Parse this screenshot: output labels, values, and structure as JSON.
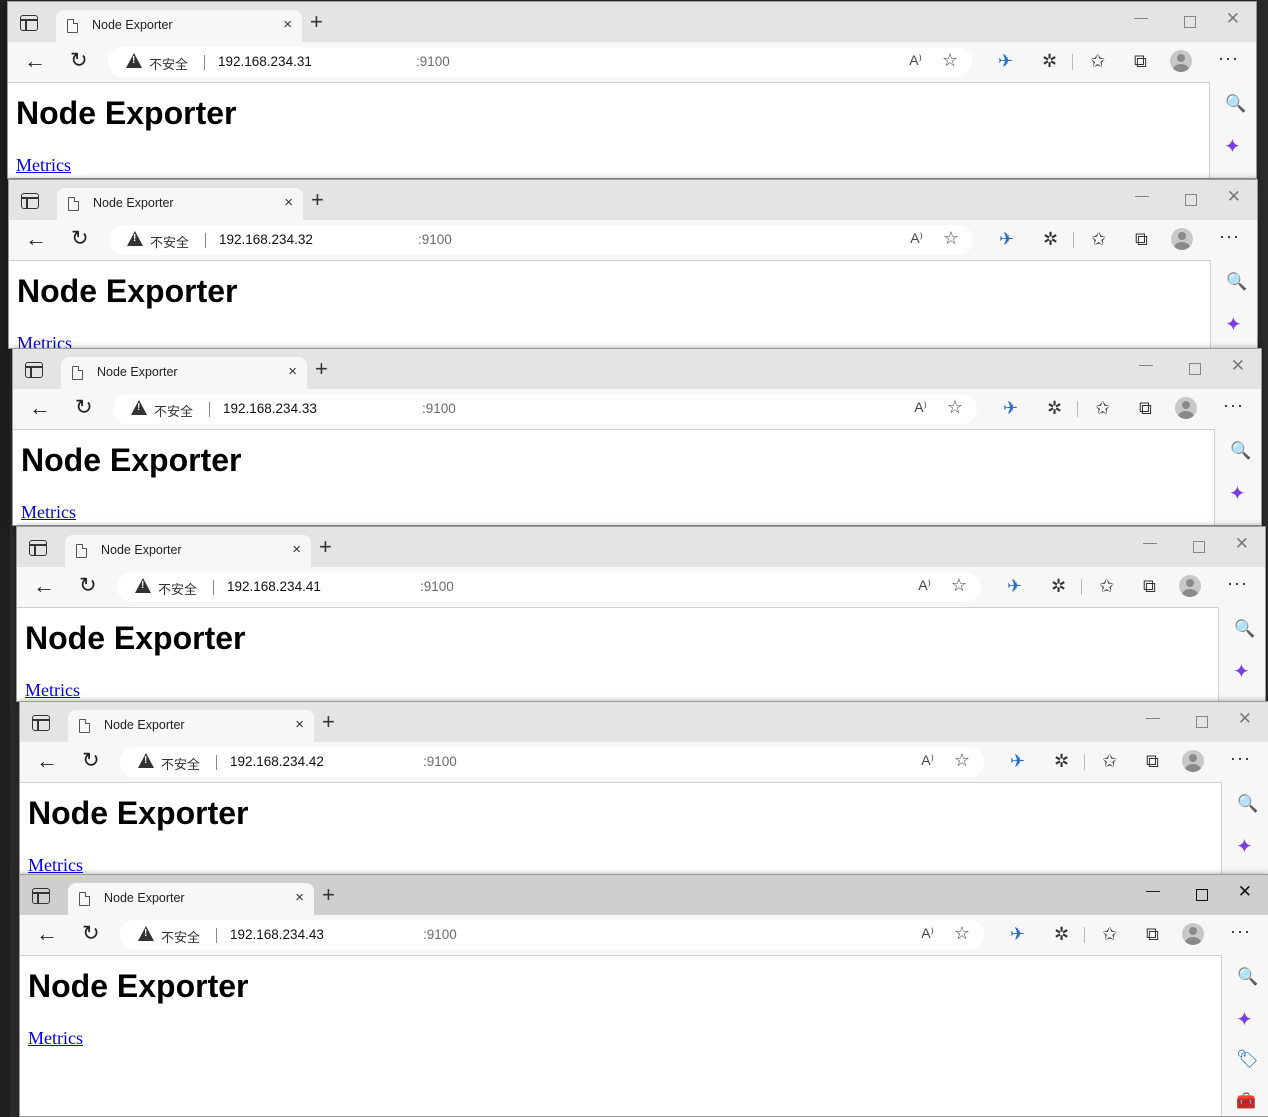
{
  "tab": {
    "title": "Node Exporter",
    "close_label": "×",
    "new_tab_label": "+"
  },
  "window_controls": {
    "minimize": "—",
    "close": "✕"
  },
  "nav": {
    "back": "←",
    "reload": "↻"
  },
  "address": {
    "security_label": "不安全"
  },
  "page": {
    "heading": "Node Exporter",
    "link_text": "Metrics"
  },
  "toolbar_icons": {
    "read_aloud": "A⁾",
    "favorite_add": "☆",
    "performance": "✈",
    "extensions": "✲",
    "favorites": "✩",
    "collections": "⧉",
    "more": "···"
  },
  "sidebar_icons": {
    "search": "🔍",
    "copilot": "✦",
    "shopping": "🏷",
    "tools": "🧰"
  },
  "windows": [
    {
      "host": "192.168.234.31",
      "port": ":9100",
      "active": false
    },
    {
      "host": "192.168.234.32",
      "port": ":9100",
      "active": false
    },
    {
      "host": "192.168.234.33",
      "port": ":9100",
      "active": false
    },
    {
      "host": "192.168.234.41",
      "port": ":9100",
      "active": false
    },
    {
      "host": "192.168.234.42",
      "port": ":9100",
      "active": false
    },
    {
      "host": "192.168.234.43",
      "port": ":9100",
      "active": true
    }
  ]
}
